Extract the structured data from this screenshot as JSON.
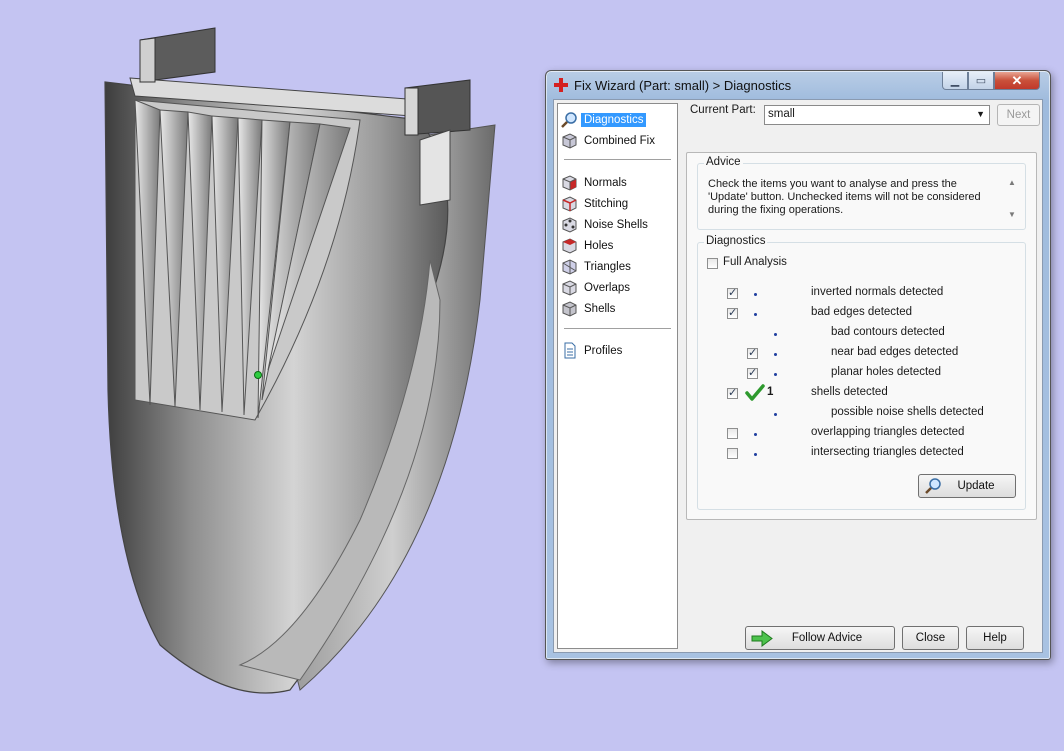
{
  "dialog": {
    "title": "Fix Wizard (Part: small) > Diagnostics",
    "sidebar": {
      "items": [
        {
          "label": "Diagnostics",
          "icon": "magnifier-icon",
          "active": true
        },
        {
          "label": "Combined Fix",
          "icon": "cube-icon"
        },
        {
          "label": "Normals",
          "icon": "normals-cube-icon"
        },
        {
          "label": "Stitching",
          "icon": "stitching-cube-icon"
        },
        {
          "label": "Noise Shells",
          "icon": "noise-shells-cube-icon"
        },
        {
          "label": "Holes",
          "icon": "holes-cube-icon"
        },
        {
          "label": "Triangles",
          "icon": "triangles-cube-icon"
        },
        {
          "label": "Overlaps",
          "icon": "overlaps-cube-icon"
        },
        {
          "label": "Shells",
          "icon": "shells-cube-icon"
        },
        {
          "label": "Profiles",
          "icon": "document-icon"
        }
      ]
    },
    "current_part": {
      "label": "Current Part:",
      "value": "small"
    },
    "next_label": "Next",
    "advice": {
      "title": "Advice",
      "text": "Check the items you want to analyse and press the 'Update' button. Unchecked items will not be considered during the fixing operations."
    },
    "diagnostics": {
      "title": "Diagnostics",
      "full_analysis_label": "Full Analysis",
      "full_analysis_checked": false,
      "items": [
        {
          "label": "inverted normals detected",
          "checked": true,
          "indent": 0,
          "checkbox": true
        },
        {
          "label": "bad edges detected",
          "checked": true,
          "indent": 0,
          "checkbox": true
        },
        {
          "label": "bad contours detected",
          "checked": false,
          "indent": 1,
          "checkbox": false
        },
        {
          "label": "near bad edges detected",
          "checked": true,
          "indent": 1,
          "checkbox": true
        },
        {
          "label": "planar holes detected",
          "checked": true,
          "indent": 1,
          "checkbox": true
        },
        {
          "label": "shells detected",
          "checked": true,
          "indent": 0,
          "checkbox": true,
          "result": "1"
        },
        {
          "label": "possible noise shells detected",
          "checked": false,
          "indent": 1,
          "checkbox": false
        },
        {
          "label": "overlapping triangles detected",
          "checked": false,
          "indent": 0,
          "checkbox": true
        },
        {
          "label": "intersecting triangles detected",
          "checked": false,
          "indent": 0,
          "checkbox": true
        }
      ],
      "update_label": "Update"
    },
    "buttons": {
      "follow_advice": "Follow Advice",
      "close": "Close",
      "help": "Help"
    }
  },
  "colors": {
    "background": "#c4c4f2",
    "selection": "#3399ff",
    "ok_check": "#2e9a2e"
  }
}
